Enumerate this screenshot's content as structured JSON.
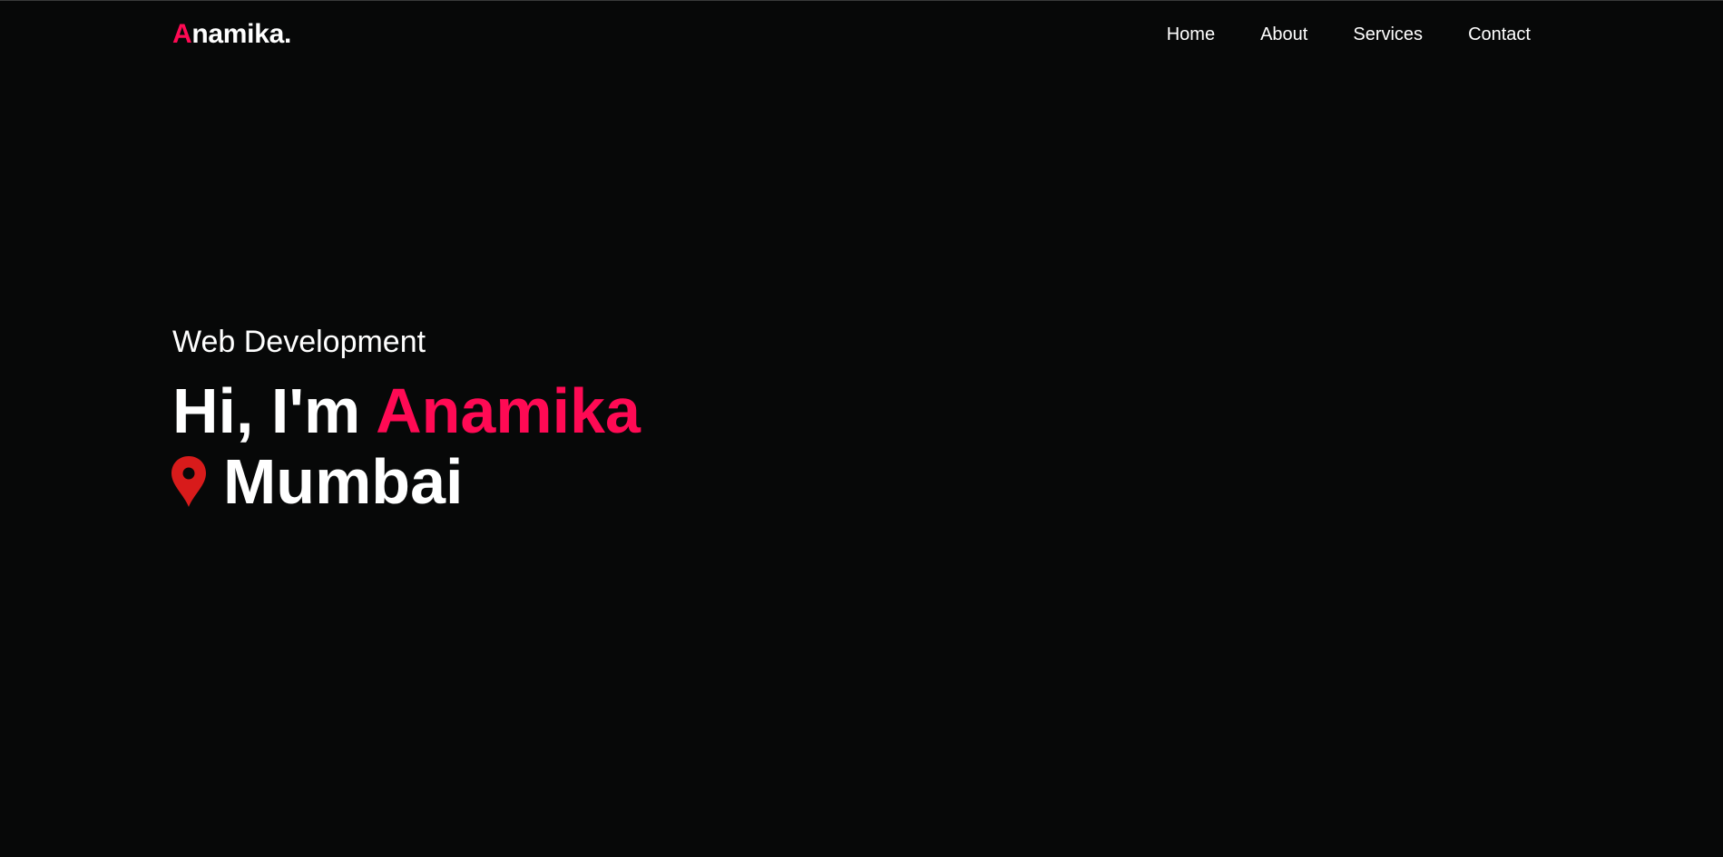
{
  "page": {
    "background_color": "#070808",
    "accent_color": "#ff0a54",
    "pin_color": "#d81b1b"
  },
  "header": {
    "logo": {
      "first_letter": "A",
      "rest": "namika."
    },
    "nav": [
      {
        "label": "Home"
      },
      {
        "label": "About"
      },
      {
        "label": "Services"
      },
      {
        "label": "Contact"
      }
    ]
  },
  "hero": {
    "subtitle": "Web Development",
    "greeting": "Hi, I'm ",
    "name": "Anamika",
    "location_icon": "map-pin-icon",
    "location": "Mumbai"
  }
}
